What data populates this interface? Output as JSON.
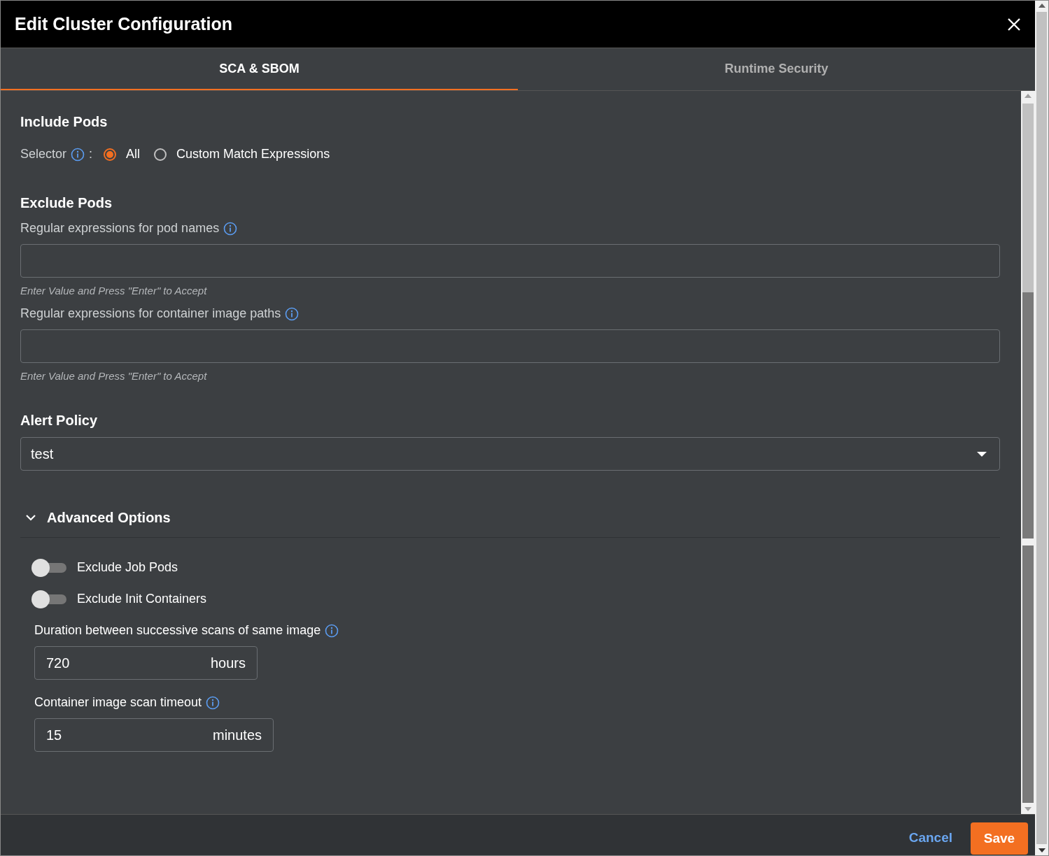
{
  "dialog": {
    "title": "Edit Cluster Configuration"
  },
  "tabs": [
    {
      "label": "SCA & SBOM",
      "selected": true
    },
    {
      "label": "Runtime Security",
      "selected": false
    }
  ],
  "include_pods": {
    "heading": "Include Pods",
    "selector_label": "Selector",
    "separator": ":",
    "options": [
      {
        "label": "All",
        "selected": true
      },
      {
        "label": "Custom Match Expressions",
        "selected": false
      }
    ]
  },
  "exclude_pods": {
    "heading": "Exclude Pods",
    "fields": [
      {
        "label": "Regular expressions for pod names",
        "helper": "Enter Value and Press \"Enter\" to Accept"
      },
      {
        "label": "Regular expressions for container image paths",
        "helper": "Enter Value and Press \"Enter\" to Accept"
      }
    ]
  },
  "alert_policy": {
    "heading": "Alert Policy",
    "value": "test"
  },
  "advanced": {
    "title": "Advanced Options",
    "expanded": true,
    "toggles": [
      {
        "label": "Exclude Job Pods",
        "on": false
      },
      {
        "label": "Exclude Init Containers",
        "on": false
      }
    ],
    "durations": [
      {
        "label": "Duration between successive scans of same image",
        "value": "720",
        "unit": "hours"
      },
      {
        "label": "Container image scan timeout",
        "value": "15",
        "unit": "minutes"
      }
    ]
  },
  "footer": {
    "cancel": "Cancel",
    "save": "Save"
  }
}
